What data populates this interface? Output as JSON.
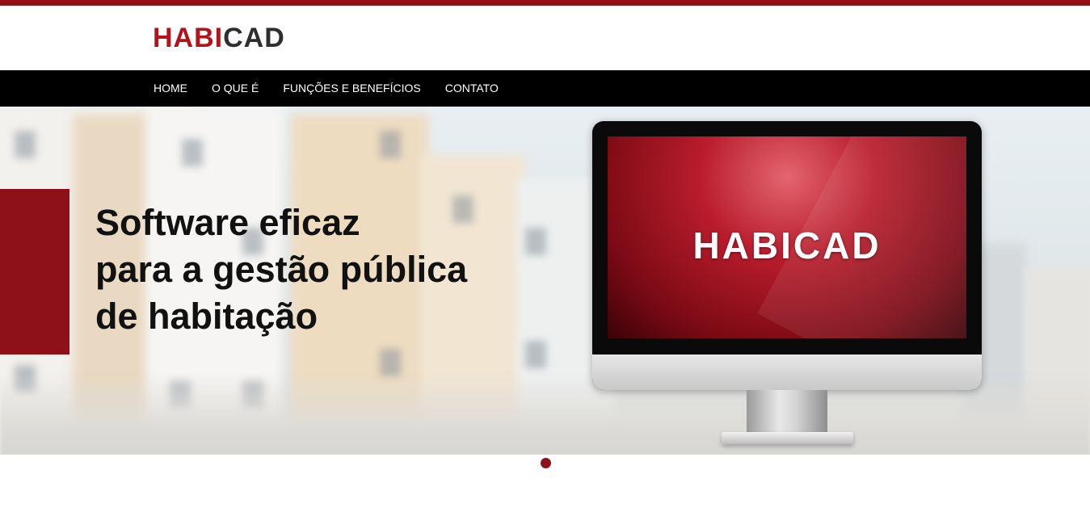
{
  "brand": {
    "logo_part_red": "HABI",
    "logo_part_dark": "CAD",
    "primary_color": "#8e1119",
    "accent_stripe_color": "#8f1116"
  },
  "nav": {
    "items": [
      {
        "label": "HOME"
      },
      {
        "label": "O QUE É"
      },
      {
        "label": "FUNÇÕES E BENEFÍCIOS"
      },
      {
        "label": "CONTATO"
      }
    ]
  },
  "hero": {
    "headline_lines": [
      "Software eficaz",
      "para a gestão pública",
      "de habitação"
    ],
    "monitor_screen_logo": "HABICAD"
  },
  "carousel": {
    "active_slide": 1,
    "slide_count": 1
  }
}
